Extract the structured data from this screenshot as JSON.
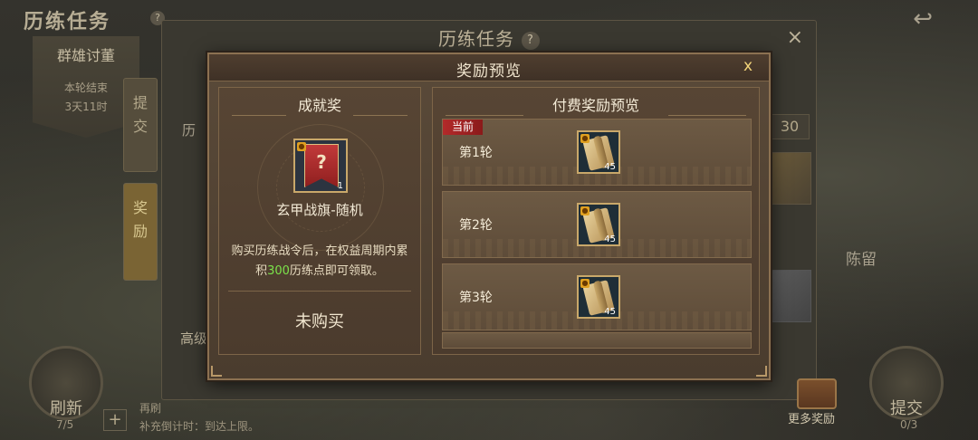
{
  "background": {
    "page_title": "历练任务",
    "banner": {
      "title": "群雄讨董",
      "line1": "本轮结束",
      "line2": "3天11时"
    },
    "side_tabs": [
      {
        "label": "提\n交",
        "active": false
      },
      {
        "label": "奖\n励",
        "active": true
      }
    ],
    "panel_title": "历练任务",
    "help_glyph": "?",
    "close_glyph": "×",
    "level_value": "30",
    "map_label": "陈留",
    "list_label_partial": "高级",
    "left_list_partial": "历",
    "refresh_button": {
      "label": "刷新",
      "count": "7/5"
    },
    "submit_button": {
      "label": "提交",
      "count": "0/3"
    },
    "plus_glyph": "+",
    "bottom_line1": "再刷",
    "bottom_line2": "补充倒计时：到达上限。",
    "more_rewards": "更多奖励",
    "back_glyph": "↩"
  },
  "modal": {
    "title": "奖励预览",
    "close_glyph": "x",
    "achievement": {
      "heading": "成就奖",
      "item_name": "玄甲战旗-随机",
      "item_glyph": "?",
      "item_qty": "1",
      "desc_prefix": "购买历练战令后，在权益周期内累积",
      "desc_highlight": "300",
      "desc_suffix": "历练点即可领取。",
      "status": "未购买"
    },
    "paid_preview": {
      "heading": "付费奖励预览",
      "current_tag": "当前",
      "rounds": [
        {
          "label": "第1轮",
          "qty": "45"
        },
        {
          "label": "第2轮",
          "qty": "45"
        },
        {
          "label": "第3轮",
          "qty": "45"
        }
      ]
    }
  },
  "colors": {
    "highlight_green": "#7be24a",
    "current_tag_red": "#b32a2a",
    "gold_border": "#c9a86a",
    "close_gold": "#f3d47a"
  }
}
